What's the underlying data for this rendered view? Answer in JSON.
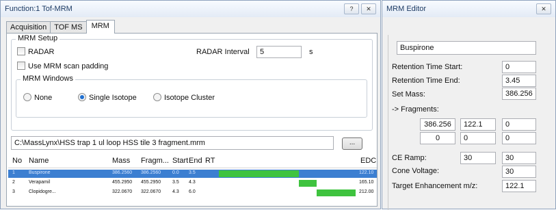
{
  "function_window": {
    "title": "Function:1 Tof-MRM",
    "help_button": "?",
    "close_button": "✕",
    "tabs": [
      "Acquisition",
      "TOF MS",
      "MRM"
    ],
    "mrm_setup": {
      "legend": "MRM Setup",
      "radar_label": "RADAR",
      "scan_padding_label": "Use MRM scan padding",
      "radar_interval_label": "RADAR Interval",
      "radar_interval_value": "5",
      "radar_interval_unit": "s",
      "mrm_windows": {
        "legend": "MRM Windows",
        "options": [
          "None",
          "Single Isotope",
          "Isotope Cluster"
        ],
        "selected": "Single Isotope"
      }
    },
    "file_path": "C:\\MassLynx\\HSS trap 1 ul loop HSS tile 3 fragment.mrm",
    "browse_button": "...",
    "table": {
      "columns": [
        "No",
        "Name",
        "Mass",
        "Fragm...",
        "Start",
        "End",
        "RT",
        "EDC"
      ],
      "rows": [
        {
          "no": "1",
          "name": "Buspirone",
          "mass": "386.2560",
          "fragment": "386.2560",
          "start": "0.0",
          "end": "3.5",
          "edc": "122.10",
          "bar_start": 0.0,
          "bar_end": 3.5,
          "selected": true
        },
        {
          "no": "2",
          "name": "Verapamil",
          "mass": "455.2950",
          "fragment": "455.2950",
          "start": "3.5",
          "end": "4.3",
          "edc": "165.10",
          "bar_start": 3.5,
          "bar_end": 4.3,
          "selected": false
        },
        {
          "no": "3",
          "name": "Clopidogre...",
          "mass": "322.0670",
          "fragment": "322.0670",
          "start": "4.3",
          "end": "6.0",
          "edc": "212.00",
          "bar_start": 4.3,
          "bar_end": 6.0,
          "selected": false
        }
      ],
      "rt_axis_max": 6.0
    }
  },
  "mrm_editor": {
    "title": "MRM Editor",
    "close_button": "✕",
    "compound_name": "Buspirone",
    "rt_start_label": "Retention Time Start:",
    "rt_start_value": "0",
    "rt_end_label": "Retention Time End:",
    "rt_end_value": "3.45",
    "set_mass_label": "Set Mass:",
    "set_mass_value": "386.256",
    "fragments_label": "-> Fragments:",
    "fragments": [
      [
        "386.256",
        "122.1",
        "0"
      ],
      [
        "0",
        "0",
        "0"
      ]
    ],
    "ce_ramp_label": "CE Ramp:",
    "ce_ramp_values": [
      "30",
      "30"
    ],
    "cone_voltage_label": "Cone Voltage:",
    "cone_voltage_value": "30",
    "target_enh_label": "Target Enhancement m/z:",
    "target_enh_value": "122.1"
  }
}
